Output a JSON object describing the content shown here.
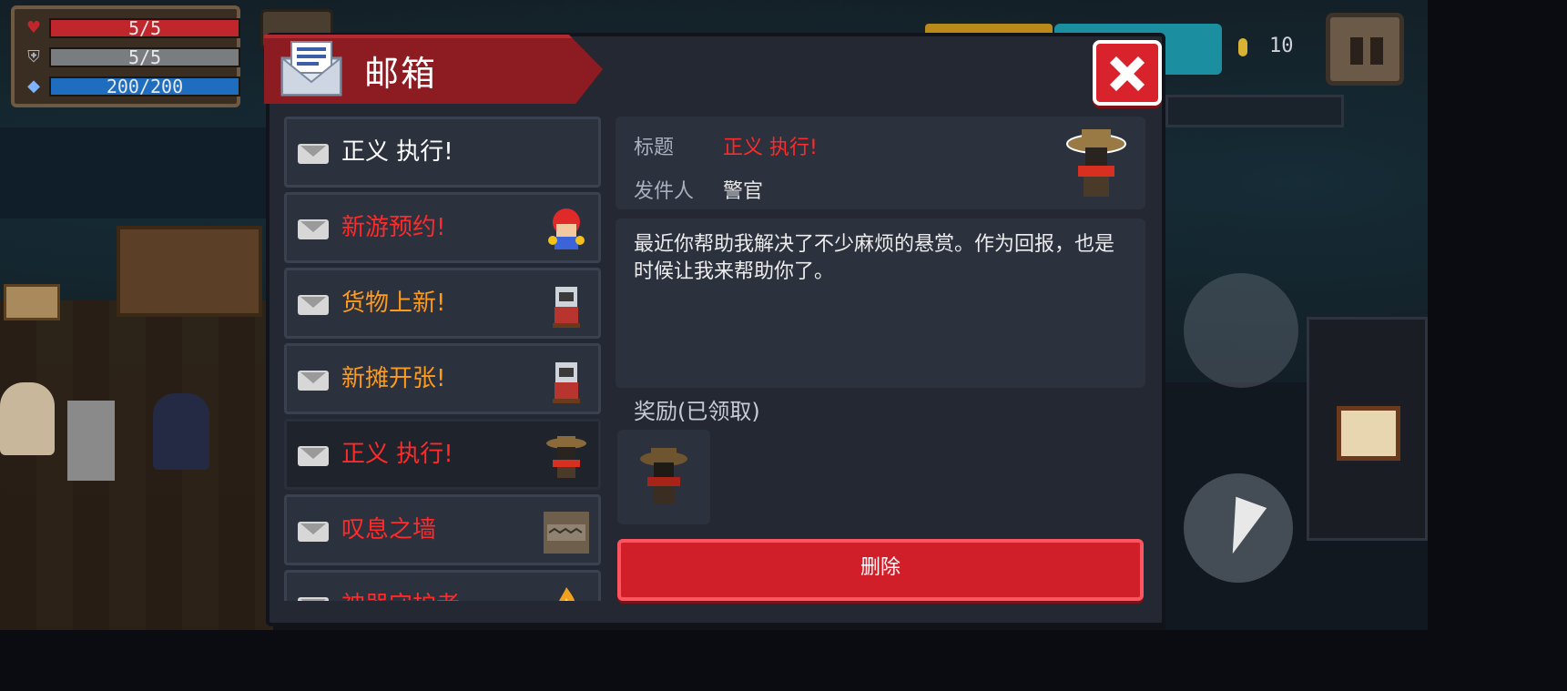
{
  "hud": {
    "health": "5/5",
    "armor": "5/5",
    "energy": "200/200",
    "coins": "10"
  },
  "mailbox": {
    "title": "邮箱",
    "messages": [
      {
        "subject": "正义 执行!",
        "color": "#ffffff",
        "thumb": "none-icon"
      },
      {
        "subject": "新游预约!",
        "color": "#ff2a2a",
        "thumb": "red-cap-kid-icon"
      },
      {
        "subject": "货物上新!",
        "color": "#ff9a1a",
        "thumb": "cat-merchant-icon"
      },
      {
        "subject": "新摊开张!",
        "color": "#ff9a1a",
        "thumb": "cat-merchant-icon"
      },
      {
        "subject": "正义 执行!",
        "color": "#ff2a2a",
        "thumb": "sheriff-icon"
      },
      {
        "subject": "叹息之墙",
        "color": "#ff2a2a",
        "thumb": "brick-wall-icon"
      },
      {
        "subject": "神器守护者",
        "color": "#ff2a2a",
        "thumb": "flame-icon"
      }
    ],
    "detail": {
      "subject_label": "标题",
      "subject": "正义 执行!",
      "sender_label": "发件人",
      "sender": "警官",
      "body": "最近你帮助我解决了不少麻烦的悬赏。作为回报，也是时候让我来帮助你了。",
      "reward_label": "奖励(已领取)",
      "delete_label": "删除"
    }
  },
  "colors": {
    "accent_red": "#d11f2a",
    "subject_red": "#ff2a2a",
    "subject_orange": "#ff9a1a"
  }
}
